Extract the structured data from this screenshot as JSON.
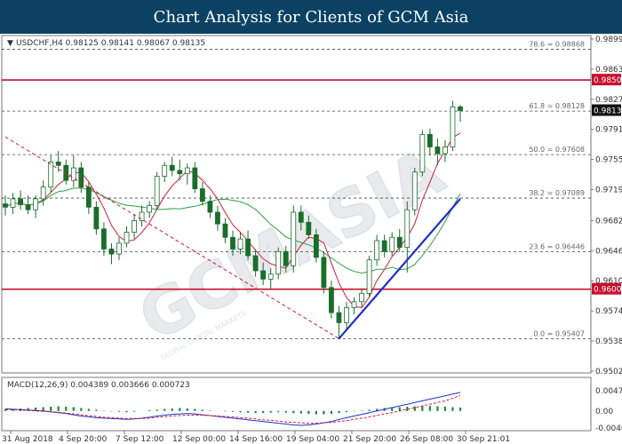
{
  "banner": {
    "title": "Chart Analysis for Clients of GCM Asia"
  },
  "header": {
    "symbol_line": "USDCHF,H4  0.98125 0.98141 0.98067 0.98135"
  },
  "macd_header": "MACD(12,26,9) 0.004389 0.003666 0.000723",
  "watermark": {
    "text": "GCMASIA",
    "sub": "GLOBAL CAPITAL MARKETS"
  },
  "colors": {
    "banner": "#0b4263",
    "ma_fast": "#d41c3c",
    "ma_slow": "#2ea043",
    "trendline": "#1f2fc8",
    "level": "#c8102e",
    "current": "#111111"
  },
  "chart_data": {
    "type": "candlestick",
    "symbol": "USDCHF",
    "timeframe": "H4",
    "ylim": [
      0.9502,
      0.99
    ]
  },
  "chart": {
    "price_ticks": [
      "0.98990",
      "0.98630",
      "0.98270",
      "0.97910",
      "0.97550",
      "0.97190",
      "0.96820",
      "0.96460",
      "0.96100",
      "0.95740",
      "0.95380",
      "0.95020"
    ],
    "time_ticks": [
      "31 Aug 2018",
      "4 Sep 20:00",
      "7 Sep 12:00",
      "12 Sep 00:00",
      "14 Sep 16:00",
      "19 Sep 04:00",
      "21 Sep 20:00",
      "26 Sep 08:00",
      "30 Sep 21:01"
    ],
    "macd_ticks": [
      "0.004791",
      "0.00",
      "-0.00404"
    ],
    "fib_levels": [
      {
        "label": "78.6 = 0.98868",
        "value": 0.98868
      },
      {
        "label": "61.8 = 0.98128",
        "value": 0.98128
      },
      {
        "label": "50.0 = 0.97608",
        "value": 0.97608
      },
      {
        "label": "38.2 = 0.97089",
        "value": 0.97089
      },
      {
        "label": "23.6 = 0.96446",
        "value": 0.96446
      },
      {
        "label": "0.0 = 0.95407",
        "value": 0.95407
      }
    ],
    "key_levels": [
      {
        "label": "0.98500",
        "value": 0.985
      },
      {
        "label": "0.96000",
        "value": 0.96
      }
    ],
    "current_price": {
      "label": "0.98135",
      "value": 0.98135
    },
    "candles": [
      [
        0.9702,
        0.9712,
        0.9688,
        0.9698
      ],
      [
        0.9698,
        0.9715,
        0.969,
        0.9708
      ],
      [
        0.9708,
        0.9718,
        0.9695,
        0.9701
      ],
      [
        0.9701,
        0.9712,
        0.969,
        0.9695
      ],
      [
        0.9695,
        0.9712,
        0.9685,
        0.9708
      ],
      [
        0.9708,
        0.973,
        0.97,
        0.9722
      ],
      [
        0.9722,
        0.976,
        0.9715,
        0.9752
      ],
      [
        0.9752,
        0.9765,
        0.974,
        0.9748
      ],
      [
        0.9748,
        0.9755,
        0.9725,
        0.973
      ],
      [
        0.973,
        0.976,
        0.9722,
        0.9745
      ],
      [
        0.9745,
        0.9752,
        0.9715,
        0.9722
      ],
      [
        0.9722,
        0.9728,
        0.969,
        0.9698
      ],
      [
        0.9698,
        0.9705,
        0.9665,
        0.9672
      ],
      [
        0.9672,
        0.968,
        0.964,
        0.9648
      ],
      [
        0.9648,
        0.9655,
        0.963,
        0.9642
      ],
      [
        0.9642,
        0.9662,
        0.9635,
        0.9655
      ],
      [
        0.9655,
        0.9675,
        0.965,
        0.9668
      ],
      [
        0.9668,
        0.969,
        0.966,
        0.9682
      ],
      [
        0.9682,
        0.97,
        0.9675,
        0.9692
      ],
      [
        0.9692,
        0.9705,
        0.9685,
        0.97
      ],
      [
        0.97,
        0.974,
        0.9695,
        0.9735
      ],
      [
        0.9735,
        0.9752,
        0.9728,
        0.9748
      ],
      [
        0.9748,
        0.9758,
        0.9735,
        0.9742
      ],
      [
        0.9742,
        0.9755,
        0.973,
        0.9738
      ],
      [
        0.9738,
        0.975,
        0.9725,
        0.9745
      ],
      [
        0.9745,
        0.9752,
        0.9715,
        0.972
      ],
      [
        0.972,
        0.9728,
        0.97,
        0.9705
      ],
      [
        0.9705,
        0.9712,
        0.9685,
        0.9692
      ],
      [
        0.9692,
        0.97,
        0.967,
        0.9678
      ],
      [
        0.9678,
        0.9685,
        0.9655,
        0.9662
      ],
      [
        0.9662,
        0.967,
        0.964,
        0.9648
      ],
      [
        0.9648,
        0.9668,
        0.9642,
        0.966
      ],
      [
        0.966,
        0.967,
        0.9635,
        0.964
      ],
      [
        0.964,
        0.9648,
        0.9615,
        0.9622
      ],
      [
        0.9622,
        0.9632,
        0.9605,
        0.9612
      ],
      [
        0.9612,
        0.9625,
        0.96,
        0.9618
      ],
      [
        0.9618,
        0.965,
        0.9612,
        0.9645
      ],
      [
        0.9645,
        0.9652,
        0.962,
        0.9628
      ],
      [
        0.9628,
        0.97,
        0.962,
        0.9692
      ],
      [
        0.9692,
        0.97,
        0.967,
        0.968
      ],
      [
        0.968,
        0.9688,
        0.966,
        0.9665
      ],
      [
        0.9665,
        0.9672,
        0.9632,
        0.9638
      ],
      [
        0.9638,
        0.9645,
        0.9595,
        0.9602
      ],
      [
        0.9602,
        0.961,
        0.9565,
        0.9572
      ],
      [
        0.9572,
        0.958,
        0.9541,
        0.956
      ],
      [
        0.956,
        0.9585,
        0.9552,
        0.9578
      ],
      [
        0.9578,
        0.959,
        0.957,
        0.9585
      ],
      [
        0.9585,
        0.96,
        0.9578,
        0.9595
      ],
      [
        0.9595,
        0.964,
        0.959,
        0.9635
      ],
      [
        0.9635,
        0.9665,
        0.9628,
        0.9658
      ],
      [
        0.9658,
        0.9665,
        0.9638,
        0.9645
      ],
      [
        0.9645,
        0.9668,
        0.964,
        0.9662
      ],
      [
        0.9662,
        0.9672,
        0.9645,
        0.965
      ],
      [
        0.965,
        0.9705,
        0.962,
        0.9695
      ],
      [
        0.9695,
        0.9745,
        0.9688,
        0.974
      ],
      [
        0.974,
        0.979,
        0.9735,
        0.9785
      ],
      [
        0.9785,
        0.9792,
        0.976,
        0.977
      ],
      [
        0.977,
        0.978,
        0.9748,
        0.9762
      ],
      [
        0.9762,
        0.9778,
        0.9752,
        0.977
      ],
      [
        0.977,
        0.9825,
        0.9765,
        0.9818
      ],
      [
        0.9818,
        0.982,
        0.98,
        0.98135
      ]
    ],
    "macd_hist": [
      0.0004,
      0.0005,
      0.0006,
      0.0007,
      0.0008,
      0.0009,
      0.001,
      0.0011,
      0.001,
      0.0009,
      0.0007,
      0.0005,
      0.0003,
      0.0001,
      -0.0001,
      -0.0002,
      -0.0003,
      -0.0002,
      0.0,
      0.0002,
      0.0003,
      0.0005,
      0.0006,
      0.0007,
      0.0006,
      0.0005,
      0.0003,
      0.0001,
      0.0,
      -0.0001,
      -0.0002,
      -0.0003,
      -0.0004,
      -0.0005,
      -0.0005,
      -0.0004,
      -0.0003,
      -0.0004,
      -0.0005,
      -0.0006,
      -0.0007,
      -0.0008,
      -0.0008,
      -0.0007,
      -0.0005,
      -0.0003,
      -0.0001,
      0.0001,
      0.0003,
      0.0005,
      0.0007,
      0.0008,
      0.0009,
      0.001,
      0.0011,
      0.0012,
      0.0012,
      0.0011,
      0.001,
      0.0009,
      0.0008
    ],
    "macd_line": [
      0.0005,
      0.0004,
      0.0003,
      0.0002,
      0.0001,
      0.0,
      -0.0002,
      -0.0004,
      -0.0006,
      -0.0009,
      -0.0012,
      -0.0014,
      -0.0016,
      -0.0017,
      -0.0018,
      -0.0019,
      -0.002,
      -0.0019,
      -0.0017,
      -0.0015,
      -0.0012,
      -0.001,
      -0.0008,
      -0.0007,
      -0.0006,
      -0.0007,
      -0.0009,
      -0.0011,
      -0.0013,
      -0.0015,
      -0.0017,
      -0.0019,
      -0.0021,
      -0.0023,
      -0.0025,
      -0.0027,
      -0.0029,
      -0.0031,
      -0.0033,
      -0.0034,
      -0.0033,
      -0.0031,
      -0.0028,
      -0.0025,
      -0.002,
      -0.0016,
      -0.0012,
      -0.0008,
      -0.0004,
      0.0,
      0.0004,
      0.0008,
      0.0012,
      0.0016,
      0.002,
      0.0024,
      0.0028,
      0.0032,
      0.0036,
      0.004,
      0.0044
    ],
    "macd_signal": [
      0.0003,
      0.0003,
      0.0002,
      0.0001,
      0.0,
      -0.0001,
      -0.0002,
      -0.0003,
      -0.0005,
      -0.0007,
      -0.0009,
      -0.0011,
      -0.0013,
      -0.0015,
      -0.0016,
      -0.0017,
      -0.0018,
      -0.0018,
      -0.0018,
      -0.0017,
      -0.0015,
      -0.0014,
      -0.0012,
      -0.0011,
      -0.001,
      -0.001,
      -0.001,
      -0.0011,
      -0.0012,
      -0.0013,
      -0.0014,
      -0.0016,
      -0.0017,
      -0.0019,
      -0.0021,
      -0.0022,
      -0.0024,
      -0.0026,
      -0.0027,
      -0.0028,
      -0.0029,
      -0.0029,
      -0.0028,
      -0.0027,
      -0.0025,
      -0.0023,
      -0.002,
      -0.0017,
      -0.0014,
      -0.0011,
      -0.0007,
      -0.0004,
      0.0,
      0.0004,
      0.0008,
      0.0012,
      0.0016,
      0.002,
      0.0024,
      0.003,
      0.0037
    ]
  }
}
